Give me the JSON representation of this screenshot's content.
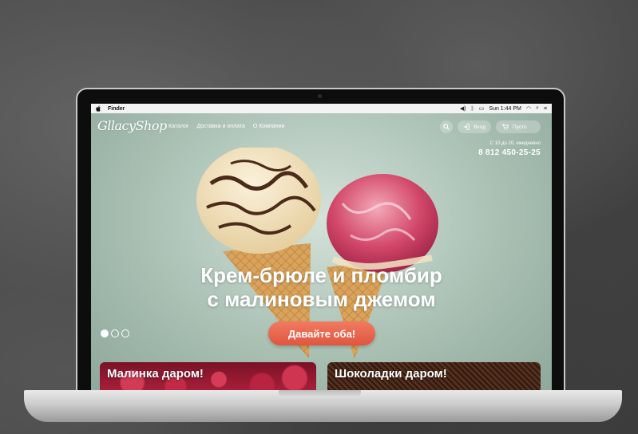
{
  "menubar": {
    "app_name": "Finder",
    "clock": "Sun 1:44 PM",
    "apple_icon": "apple-icon",
    "icons": [
      "volume-icon",
      "bluetooth-icon",
      "wifi-icon",
      "search-icon",
      "list-icon"
    ]
  },
  "site": {
    "logo": "GllacyShop",
    "nav": [
      "Каталог",
      "Доставка и оплата",
      "О Компании"
    ],
    "login_label": "Вход",
    "cart_label": "Пусто",
    "hours": "С 10 до 20, ежедневно",
    "phone": "8 812 450-25-25"
  },
  "hero": {
    "title_line1": "Крем-брюле и пломбир",
    "title_line2": "с малиновым джемом",
    "cta": "Давайте оба!",
    "slides_count": 3,
    "active_slide": 1
  },
  "promos": [
    {
      "label": "Малинка даром!"
    },
    {
      "label": "Шоколадки даром!"
    }
  ],
  "colors": {
    "hero_bg": "#a9c0b3",
    "cta": "#e9654b"
  }
}
